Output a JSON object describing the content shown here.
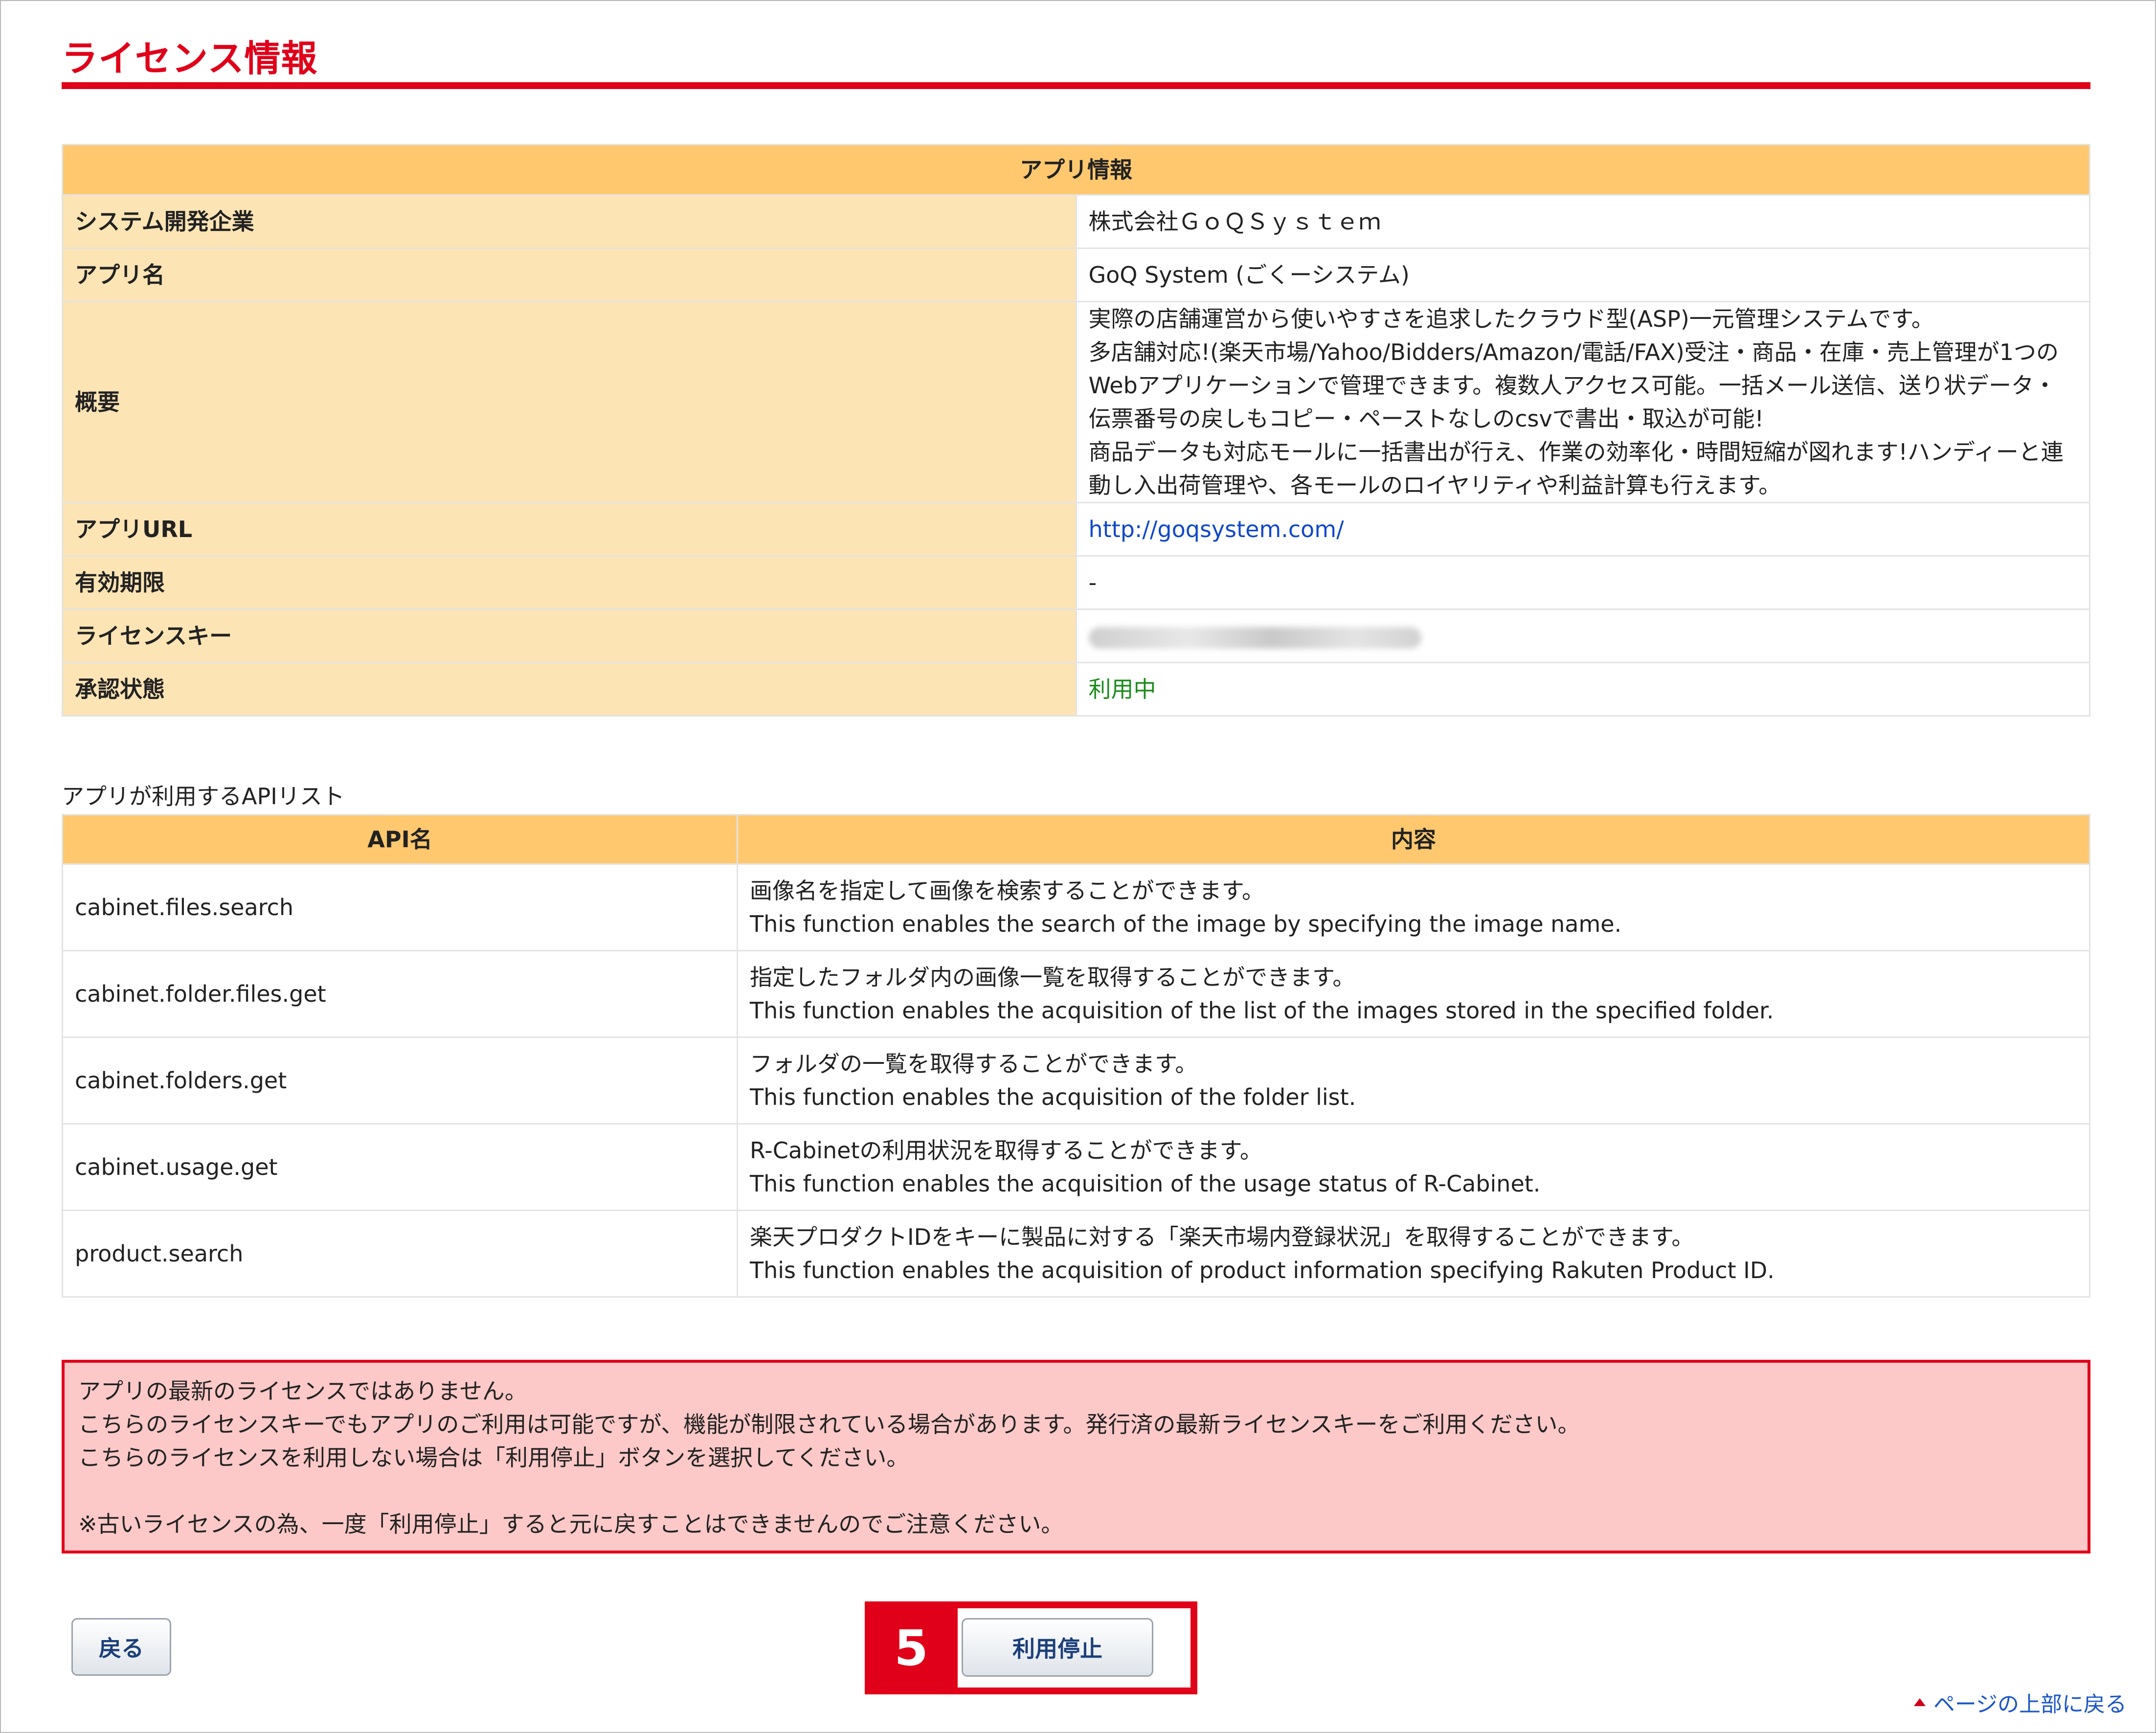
{
  "page": {
    "title": "ライセンス情報"
  },
  "app_info": {
    "header": "アプリ情報",
    "rows": [
      {
        "label": "システム開発企業",
        "value": "株式会社ＧｏＱＳｙｓｔｅｍ"
      },
      {
        "label": "アプリ名",
        "value": "GoQ System (ごくーシステム)"
      },
      {
        "label": "概要",
        "value": "実際の店舗運営から使いやすさを追求したクラウド型(ASP)一元管理システムです。\n多店舗対応!(楽天市場/Yahoo/Bidders/Amazon/電話/FAX)受注・商品・在庫・売上管理が1つのWebアプリケーションで管理できます。複数人アクセス可能。一括メール送信、送り状データ・伝票番号の戻しもコピー・ペーストなしのcsvで書出・取込が可能!\n商品データも対応モールに一括書出が行え、作業の効率化・時間短縮が図れます!ハンディーと連動し入出荷管理や、各モールのロイヤリティや利益計算も行えます。"
      },
      {
        "label": "アプリURL",
        "value": "http://goqsystem.com/"
      },
      {
        "label": "有効期限",
        "value": "-"
      },
      {
        "label": "ライセンスキー",
        "value": ""
      },
      {
        "label": "承認状態",
        "value": "利用中"
      }
    ],
    "status_color": "#1a8c1a"
  },
  "api_list": {
    "caption": "アプリが利用するAPIリスト",
    "columns": [
      "API名",
      "内容"
    ],
    "rows": [
      {
        "name": "cabinet.files.search",
        "desc_ja": "画像名を指定して画像を検索することができます。",
        "desc_en": "This function enables the search of the image by specifying the image name."
      },
      {
        "name": "cabinet.folder.files.get",
        "desc_ja": "指定したフォルダ内の画像一覧を取得することができます。",
        "desc_en": "This function enables the acquisition of the list of the images stored in the specified folder."
      },
      {
        "name": "cabinet.folders.get",
        "desc_ja": "フォルダの一覧を取得することができます。",
        "desc_en": "This function enables the acquisition of the folder list."
      },
      {
        "name": "cabinet.usage.get",
        "desc_ja": "R-Cabinetの利用状況を取得することができます。",
        "desc_en": "This function enables the acquisition of the usage status of R-Cabinet."
      },
      {
        "name": "product.search",
        "desc_ja": "楽天プロダクトIDをキーに製品に対する「楽天市場内登録状況」を取得することができます。",
        "desc_en": "This function enables the acquisition of product information specifying Rakuten Product ID."
      }
    ]
  },
  "notice": {
    "line1": "アプリの最新のライセンスではありません。",
    "line2": "こちらのライセンスキーでもアプリのご利用は可能ですが、機能が制限されている場合があります。発行済の最新ライセンスキーをご利用ください。",
    "line3": "こちらのライセンスを利用しない場合は「利用停止」ボタンを選択してください。",
    "line4": "※古いライセンスの為、一度「利用停止」すると元に戻すことはできませんのでご注意ください。"
  },
  "buttons": {
    "back": "戻る",
    "stop": "利用停止"
  },
  "callout": {
    "number": "5"
  },
  "footer": {
    "to_top": "ページの上部に戻る"
  },
  "colors": {
    "accent_red": "#e0001a",
    "header_orange": "#ffc86e",
    "label_bg": "#fde4b4",
    "notice_bg": "#fdc8c8",
    "link_blue": "#1048c8"
  }
}
